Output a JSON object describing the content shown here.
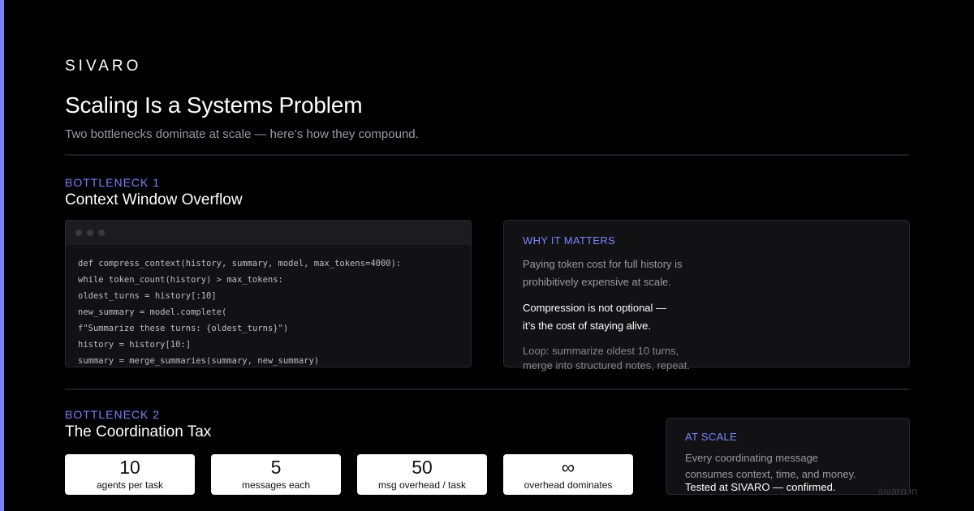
{
  "colors": {
    "accent": "#7b83ff",
    "background": "#000000",
    "card": "#121214"
  },
  "brand": "SIVARO",
  "title": "Scaling Is a Systems Problem",
  "subtitle": "Two bottlenecks dominate at scale — here’s how they compound.",
  "bottleneck1": {
    "eyebrow": "BOTTLENECK 1",
    "heading": "Context Window Overflow",
    "code": [
      "def compress_context(history, summary, model, max_tokens=4000):",
      "while token_count(history) > max_tokens:",
      "oldest_turns = history[:10]",
      "new_summary = model.complete(",
      "f\"Summarize these turns: {oldest_turns}\")",
      "history = history[10:]",
      "summary = merge_summaries(summary, new_summary)"
    ],
    "why": {
      "label": "WHY IT MATTERS",
      "p1_line1": "Paying token cost for full history is",
      "p1_line2": "prohibitively expensive at scale.",
      "p2_line1": "Compression is not optional —",
      "p2_line2": "it’s the cost of staying alive.",
      "p3_line1": "Loop: summarize oldest 10 turns,",
      "p3_line2": "merge into structured notes, repeat."
    }
  },
  "bottleneck2": {
    "eyebrow": "BOTTLENECK 2",
    "heading": "The Coordination Tax",
    "stats": [
      {
        "value": "10",
        "label": "agents per task"
      },
      {
        "value": "5",
        "label": "messages each"
      },
      {
        "value": "50",
        "label": "msg overhead / task"
      },
      {
        "value": "∞",
        "label": "overhead dominates"
      }
    ],
    "scale": {
      "label": "AT SCALE",
      "line1": "Every coordinating message",
      "line2": "consumes context, time, and money.",
      "line3": "Tested at SIVARO — confirmed."
    }
  },
  "watermark": "sivaro.in"
}
